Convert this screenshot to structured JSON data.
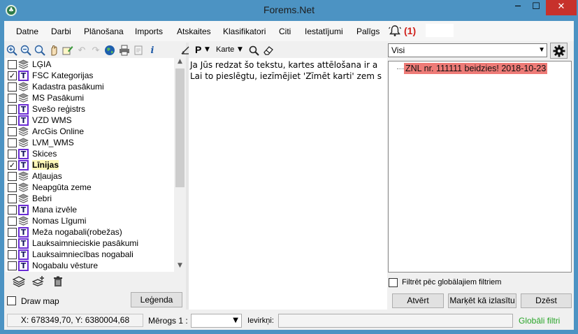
{
  "window": {
    "title": "Forems.Net",
    "minimize_glyph": "─",
    "maximize_glyph": "☐",
    "close_glyph": "✕"
  },
  "menu": {
    "items": [
      "Datne",
      "Darbi",
      "Plānošana",
      "Imports",
      "Atskaites",
      "Klasifikatori",
      "Citi",
      "Iestatījumi",
      "Palīgs"
    ],
    "notification_count": "(1)"
  },
  "left_toolbar": {
    "icons": [
      "zoom-in-icon",
      "zoom-out-icon",
      "zoom-full-icon",
      "pan-icon",
      "edit-layer-icon",
      "undo-icon",
      "redo-icon",
      "globe-icon",
      "print-icon",
      "export-icon",
      "info-icon"
    ]
  },
  "layers": [
    {
      "name": "LĢIA",
      "type": "stack",
      "checked": false,
      "highlight": false
    },
    {
      "name": "FSC Kategorijas",
      "type": "text",
      "checked": true,
      "highlight": false
    },
    {
      "name": "Kadastra pasākumi",
      "type": "stack",
      "checked": false,
      "highlight": false
    },
    {
      "name": "MS Pasākumi",
      "type": "stack",
      "checked": false,
      "highlight": false
    },
    {
      "name": "Svešo reģistrs",
      "type": "text",
      "checked": false,
      "highlight": false
    },
    {
      "name": "VZD WMS",
      "type": "text",
      "checked": false,
      "highlight": false
    },
    {
      "name": "ArcGis Online",
      "type": "stack",
      "checked": false,
      "highlight": false
    },
    {
      "name": "LVM_WMS",
      "type": "stack",
      "checked": false,
      "highlight": false
    },
    {
      "name": "Skices",
      "type": "text",
      "checked": false,
      "highlight": false
    },
    {
      "name": "Līnijas",
      "type": "text",
      "checked": true,
      "highlight": true
    },
    {
      "name": "Atļaujas",
      "type": "stack",
      "checked": false,
      "highlight": false
    },
    {
      "name": "Neapgūta zeme",
      "type": "stack",
      "checked": false,
      "highlight": false
    },
    {
      "name": "Bebri",
      "type": "stack",
      "checked": false,
      "highlight": false
    },
    {
      "name": "Mana izvēle",
      "type": "text",
      "checked": false,
      "highlight": false
    },
    {
      "name": "Nomas Līgumi",
      "type": "stack",
      "checked": false,
      "highlight": false
    },
    {
      "name": "Meža nogabali(robežas)",
      "type": "text",
      "checked": false,
      "highlight": false
    },
    {
      "name": "Lauksaimnieciskie pasākumi",
      "type": "text",
      "checked": false,
      "highlight": false
    },
    {
      "name": "Lauksaimniecības nogabali",
      "type": "text",
      "checked": false,
      "highlight": false
    },
    {
      "name": "Nogabalu vēsture",
      "type": "text",
      "checked": false,
      "highlight": false
    }
  ],
  "left_panel": {
    "draw_map_label": "Draw map",
    "legend_button": "Leģenda"
  },
  "map_toolbar": {
    "p_label": "P",
    "map_label": "Karte"
  },
  "map": {
    "line1": "Ja Jūs redzat šo tekstu, kartes attēlošana ir a",
    "line2": "Lai to pieslēgtu, iezīmējiet 'Zīmēt karti' zem s"
  },
  "notifications": {
    "filter_value": "Visi",
    "entries": [
      "ZNL nr. 111111 beidzies! 2018-10-23"
    ],
    "global_filter_label": "Filtrēt pēc globālajiem filtriem",
    "open_button": "Atvērt",
    "mark_read_button": "Marķēt kā izlasītu",
    "delete_button": "Dzēst"
  },
  "status": {
    "coords": "X: 678349,70, Y: 6380004,68",
    "scale_label": "Mērogs 1 :",
    "scale_value": "",
    "enter_label": "Ievirkņi:",
    "enter_value": "",
    "global_filters": "Globāli filtri"
  }
}
